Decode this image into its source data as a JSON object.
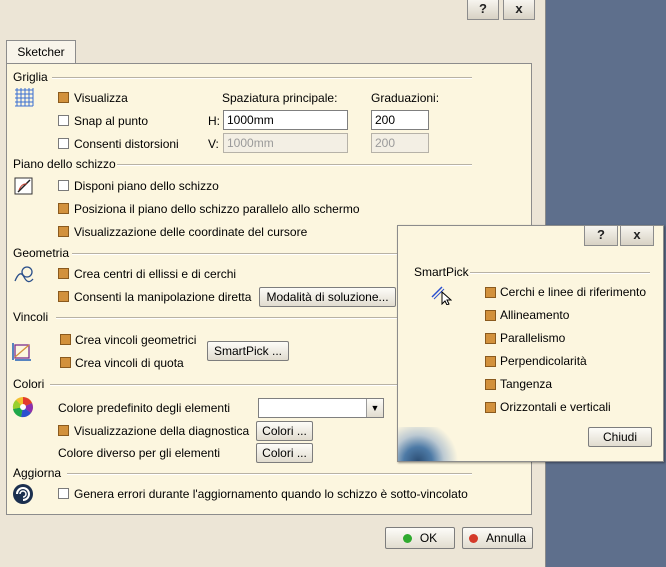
{
  "window": {
    "help_label": "?",
    "close_label": "x"
  },
  "tab": {
    "label": "Sketcher"
  },
  "griglia": {
    "title": "Griglia",
    "visualizza": {
      "label": "Visualizza",
      "checked": true
    },
    "snap": {
      "label": "Snap al punto",
      "checked": false
    },
    "distorsioni": {
      "label": "Consenti distorsioni",
      "checked": false
    },
    "spaziatura_label": "Spaziatura principale:",
    "graduazioni_label": "Graduazioni:",
    "h_label": "H:",
    "v_label": "V:",
    "h_value": "1000mm",
    "v_value": "1000mm",
    "grad_h_value": "200",
    "grad_v_value": "200"
  },
  "piano": {
    "title": "Piano dello schizzo",
    "items": [
      {
        "label": "Disponi piano dello schizzo",
        "checked": false
      },
      {
        "label": "Posiziona il piano dello schizzo parallelo allo schermo",
        "checked": true
      },
      {
        "label": "Visualizzazione delle coordinate del cursore",
        "checked": true
      }
    ]
  },
  "geometria": {
    "title": "Geometria",
    "items": [
      {
        "label": "Crea centri di ellissi e di cerchi",
        "checked": true
      },
      {
        "label": "Consenti la manipolazione diretta",
        "checked": true
      }
    ],
    "modalita_button": "Modalità di soluzione..."
  },
  "vincoli": {
    "title": "Vincoli",
    "items": [
      {
        "label": "Crea vincoli geometrici",
        "checked": true
      },
      {
        "label": "Crea vincoli di quota",
        "checked": true
      }
    ],
    "smartpick_button": "SmartPick ..."
  },
  "colori": {
    "title": "Colori",
    "predefinito_label": "Colore predefinito degli elementi",
    "predefinito_value": "",
    "diagnostica": {
      "label": "Visualizzazione della diagnostica",
      "checked": true
    },
    "diverso_label": "Colore diverso per gli elementi",
    "colori_button": "Colori ..."
  },
  "aggiorna": {
    "title": "Aggiorna",
    "genera": {
      "label": "Genera errori durante l'aggiornamento quando lo schizzo è sotto-vincolato",
      "checked": false
    }
  },
  "footer": {
    "ok_label": "OK",
    "annulla_label": "Annulla",
    "ok_color": "#2faa2f",
    "annulla_color": "#d43a2a"
  },
  "smartpick_popup": {
    "help_label": "?",
    "close_label": "x",
    "title": "SmartPick",
    "items": [
      {
        "label": "Cerchi e linee di riferimento",
        "checked": true
      },
      {
        "label": "Allineamento",
        "checked": true
      },
      {
        "label": "Parallelismo",
        "checked": true
      },
      {
        "label": "Perpendicolarità",
        "checked": true
      },
      {
        "label": "Tangenza",
        "checked": true
      },
      {
        "label": "Orizzontali e verticali",
        "checked": true
      }
    ],
    "chiudi_button": "Chiudi"
  }
}
